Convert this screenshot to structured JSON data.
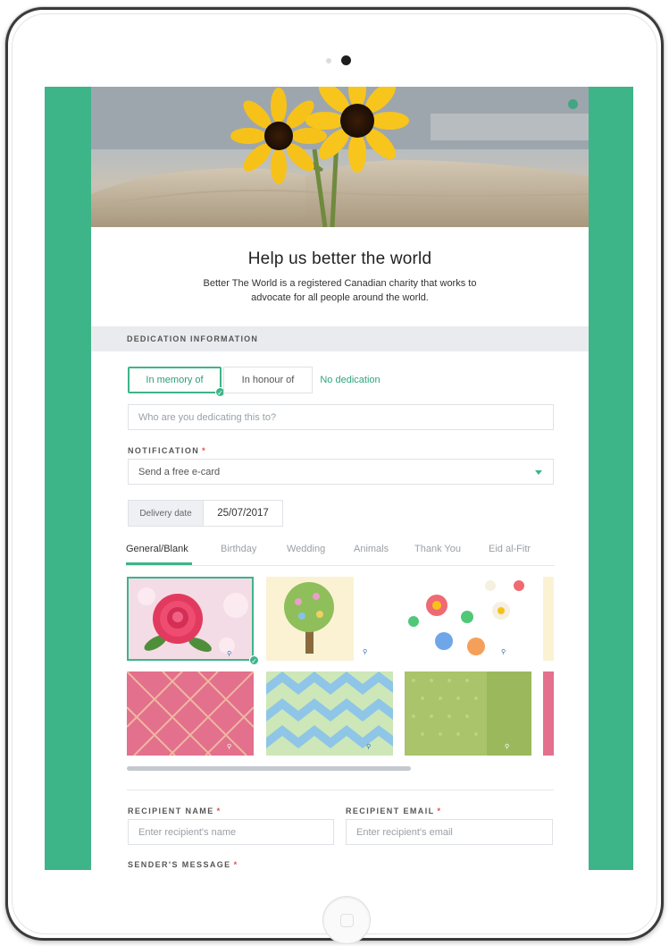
{
  "header": {
    "title": "Help us better the world",
    "subtitle": "Better The World is a registered Canadian charity that works to advocate for all people around the world."
  },
  "dedication": {
    "section_title": "DEDICATION INFORMATION",
    "options": [
      "In memory of",
      "In honour of",
      "No dedication"
    ],
    "selected": "In memory of",
    "dedicatee_placeholder": "Who are you dedicating this to?"
  },
  "notification": {
    "label": "NOTIFICATION",
    "required": "*",
    "value": "Send a free e-card"
  },
  "delivery": {
    "label": "Delivery date",
    "value": "25/07/2017"
  },
  "card_tabs": [
    "General/Blank",
    "Birthday",
    "Wedding",
    "Animals",
    "Thank You",
    "Eid al-Fitr"
  ],
  "cards": [
    {
      "theme": "rose",
      "selected": true
    },
    {
      "theme": "tree",
      "selected": false
    },
    {
      "theme": "flowers",
      "selected": false
    },
    {
      "theme": "pink-plaid",
      "selected": false
    },
    {
      "theme": "zigzag",
      "selected": false
    },
    {
      "theme": "green-pattern",
      "selected": false
    }
  ],
  "recipient": {
    "name_label": "RECIPIENT NAME",
    "name_placeholder": "Enter recipient's name",
    "email_label": "RECIPIENT EMAIL",
    "email_placeholder": "Enter recipient's email",
    "required": "*"
  },
  "sender": {
    "message_label": "SENDER'S MESSAGE",
    "required": "*"
  },
  "colors": {
    "accent": "#3eb489",
    "required": "#e24c4c",
    "section_bg": "#e9ebee"
  }
}
